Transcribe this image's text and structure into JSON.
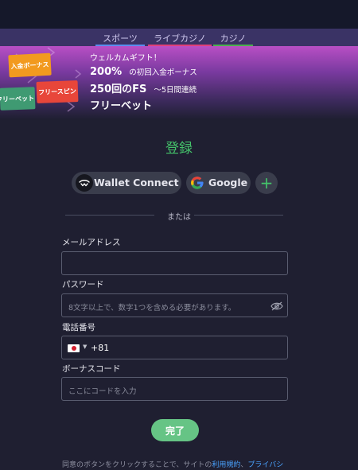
{
  "nav": {
    "tabs": [
      {
        "label": "スポーツ",
        "color": "#5b8def"
      },
      {
        "label": "ライブカジノ",
        "color": "#e0407a"
      },
      {
        "label": "カジノ",
        "color": "#4caf50"
      }
    ]
  },
  "banner": {
    "badges": [
      "入金ボーナス",
      "フリースピン",
      "フリーベット"
    ],
    "line1": "ウェルカムギフト！",
    "line2_big": "200%",
    "line2_small": "の初回入金ボーナス",
    "line3_big": "250回のFS",
    "line3_small": "～5日間連続",
    "line4": "フリーベット"
  },
  "form": {
    "title": "登録",
    "social": {
      "wallet": "Wallet Connect",
      "google": "Google",
      "more": "+"
    },
    "or": "または",
    "email_label": "メールアドレス",
    "email_value": "",
    "password_label": "パスワード",
    "password_placeholder": "8文字以上で、数字1つを含める必要があります。",
    "phone_label": "電話番号",
    "phone_code": "+81",
    "promo_label": "ボーナスコード",
    "promo_placeholder": "ここにコードを入力",
    "submit": "完了",
    "terms_prefix": "同意のボタンをクリックすることで、サイトの",
    "terms_link": "利用規約",
    "terms_sep": "、",
    "privacy_link": "プライバシ"
  },
  "colors": {
    "accent": "#44c36a",
    "button": "#66c485",
    "link": "#4aa3ff"
  }
}
